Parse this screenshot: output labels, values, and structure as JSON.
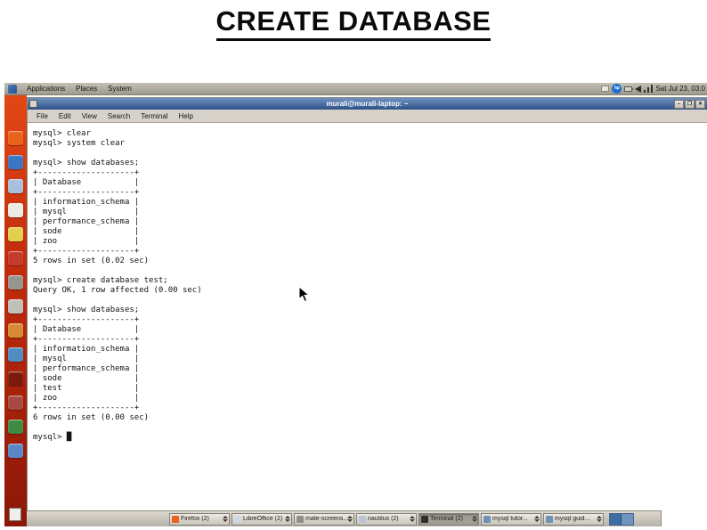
{
  "slide": {
    "title": "CREATE DATABASE"
  },
  "desktop": {
    "top_panel": {
      "menus": [
        {
          "label": "Applications"
        },
        {
          "label": "Places"
        },
        {
          "label": "System"
        }
      ],
      "tray": {
        "hp_logo": "hp",
        "clock": "Sat Jul 23, 03:0"
      }
    },
    "dock": {
      "icons": [
        {
          "name": "firefox-icon",
          "color": "#e8641c"
        },
        {
          "name": "web-globe-icon",
          "color": "#3b76c4"
        },
        {
          "name": "email-icon",
          "color": "#a9c0dc"
        },
        {
          "name": "document-icon",
          "color": "#eceae4"
        },
        {
          "name": "edit-note-icon",
          "color": "#e3cf4e"
        },
        {
          "name": "media-player-icon",
          "color": "#c23b2b"
        },
        {
          "name": "computer-icon",
          "color": "#97958f"
        },
        {
          "name": "calculator-icon",
          "color": "#c2c0ba"
        },
        {
          "name": "folder-icon",
          "color": "#d78a33"
        },
        {
          "name": "suite-icon",
          "color": "#4f8cc0"
        },
        {
          "name": "dc-app-icon",
          "color": "#7c1a0e"
        },
        {
          "name": "photos-icon",
          "color": "#a84a43"
        },
        {
          "name": "terminal-app-icon",
          "color": "#3f8a42"
        },
        {
          "name": "text-editor-icon",
          "color": "#5a88c4"
        }
      ]
    },
    "terminal_window": {
      "title": "murali@murali-laptop: ~",
      "controls": {
        "minimize": "–",
        "maximize": "❐",
        "close": "✕"
      },
      "menu": [
        {
          "label": "File"
        },
        {
          "label": "Edit"
        },
        {
          "label": "View"
        },
        {
          "label": "Search"
        },
        {
          "label": "Terminal"
        },
        {
          "label": "Help"
        }
      ],
      "screen_text": "mysql> clear\nmysql> system clear\n\nmysql> show databases;\n+--------------------+\n| Database           |\n+--------------------+\n| information_schema |\n| mysql              |\n| performance_schema |\n| sode               |\n| zoo                |\n+--------------------+\n5 rows in set (0.02 sec)\n\nmysql> create database test;\nQuery OK, 1 row affected (0.00 sec)\n\nmysql> show databases;\n+--------------------+\n| Database           |\n+--------------------+\n| information_schema |\n| mysql              |\n| performance_schema |\n| sode               |\n| test               |\n| zoo                |\n+--------------------+\n6 rows in set (0.00 sec)\n\nmysql> █"
    },
    "taskbar": {
      "buttons": [
        {
          "label": "Firefox (2)",
          "color": "#e8641c",
          "active": false
        },
        {
          "label": "LibreOffice (2)",
          "color": "#cfd8e8",
          "active": false
        },
        {
          "label": "mate-screens...",
          "color": "#8f8f8a",
          "active": false
        },
        {
          "label": "nautilus (2)",
          "color": "#b9c4d4",
          "active": false
        },
        {
          "label": "Terminal (2)",
          "color": "#2e2e2e",
          "active": true
        },
        {
          "label": "mysql tutor...",
          "color": "#6f93b8",
          "active": false
        },
        {
          "label": "mysql guid...",
          "color": "#6f93b8",
          "active": false
        }
      ]
    }
  }
}
